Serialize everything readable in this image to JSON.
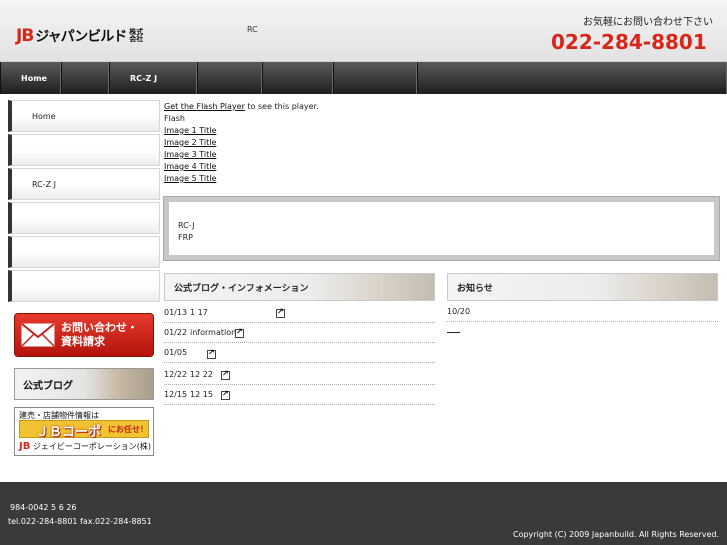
{
  "header": {
    "logo_jb": "JB",
    "logo_kana": "ジャパンビルド",
    "logo_corp": "株式会社",
    "rc": "RC",
    "contact_text": "お気軽にお問い合わせ下さい",
    "phone": "022-284-8801"
  },
  "nav": [
    "Home",
    "",
    "RC-Z J",
    "",
    "",
    "",
    ""
  ],
  "sidebar": {
    "items": [
      "Home",
      "",
      "RC-Z J",
      "",
      "",
      ""
    ],
    "contact_button": [
      "お問い合わせ・",
      "資料請求"
    ],
    "blog_button": "公式ブログ",
    "jbcorp": {
      "line1": "建売・店舗物件情報は",
      "line2_big": "ＪＢコーポ",
      "line2_small": "にお任せ！",
      "line3_mark": "JB",
      "line3": "ジェイビーコーポレーション(株)"
    }
  },
  "flash": {
    "get_player_link": "Get the Flash Player",
    "get_player_suffix": " to see this player.",
    "label": "Flash",
    "images": [
      "Image 1 Title",
      "Image 2 Title",
      "Image 3 Title",
      "Image 4 Title",
      "Image 5 Title"
    ]
  },
  "info_box": {
    "line1": "RC-J",
    "line2": "FRP"
  },
  "blog": {
    "heading": "公式ブログ・インフォメーション",
    "rows": [
      {
        "date": "01/13",
        "title": "1 17"
      },
      {
        "date": "01/22",
        "title": "information"
      },
      {
        "date": "01/05",
        "title": ""
      },
      {
        "date": "12/22",
        "title": "12 22"
      },
      {
        "date": "12/15",
        "title": "12 15"
      }
    ]
  },
  "news": {
    "heading": "お知らせ",
    "date": "10/20"
  },
  "footer": {
    "address": "984-0042          5  6 26",
    "tel": "tel.022-284-8801 fax.022-284-8851",
    "copyright": "Copyright (C) 2009 Japanbuild. All Rights Reserved."
  },
  "colors": {
    "brand_red": "#d8261a",
    "nav_dark": "#1e1e1e",
    "footer_bg": "#3a3a3a"
  }
}
